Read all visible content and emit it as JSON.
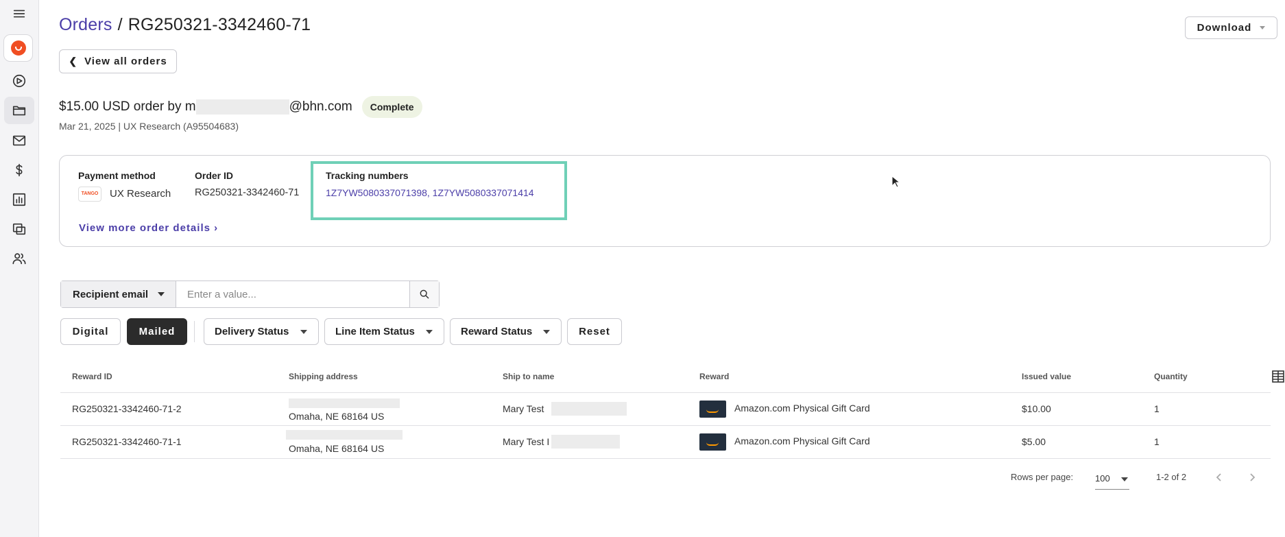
{
  "header": {
    "breadcrumb_root": "Orders",
    "separator": "/",
    "order_ref": "RG250321-3342460-71",
    "download_label": "Download",
    "view_all_label": "View all orders"
  },
  "order": {
    "amount_prefix": "$15.00 USD order by m",
    "email_suffix": "@bhn.com",
    "status": "Complete",
    "subline": "Mar 21, 2025 | UX Research (A95504683)"
  },
  "details": {
    "payment_label": "Payment method",
    "payment_logo_text": "TANGO",
    "payment_value": "UX Research",
    "order_id_label": "Order ID",
    "order_id_value": "RG250321-3342460-71",
    "tracking_label": "Tracking numbers",
    "tracking_value": "1Z7YW5080337071398, 1Z7YW5080337071414",
    "more_link": "View more order details"
  },
  "search": {
    "field": "Recipient email",
    "placeholder": "Enter a value..."
  },
  "filters": {
    "digital": "Digital",
    "mailed": "Mailed",
    "delivery_status": "Delivery Status",
    "line_item_status": "Line Item Status",
    "reward_status": "Reward Status",
    "reset": "Reset"
  },
  "table": {
    "columns": [
      "Reward ID",
      "Shipping address",
      "Ship to name",
      "Reward",
      "Issued value",
      "Quantity"
    ],
    "rows": [
      {
        "reward_id": "RG250321-3342460-71-2",
        "address": "Omaha, NE 68164 US",
        "ship_to": "Mary Test",
        "reward": "Amazon.com Physical Gift Card",
        "value": "$10.00",
        "qty": "1"
      },
      {
        "reward_id": "RG250321-3342460-71-1",
        "address": "Omaha, NE 68164 US",
        "ship_to": "Mary Test I",
        "reward": "Amazon.com Physical Gift Card",
        "value": "$5.00",
        "qty": "1"
      }
    ]
  },
  "pagination": {
    "rows_label": "Rows per page:",
    "rows_value": "100",
    "range": "1-2 of 2"
  },
  "colors": {
    "accent": "#4b3ea8",
    "highlight": "#6fd0b7",
    "badge_bg": "#eef3e3"
  }
}
